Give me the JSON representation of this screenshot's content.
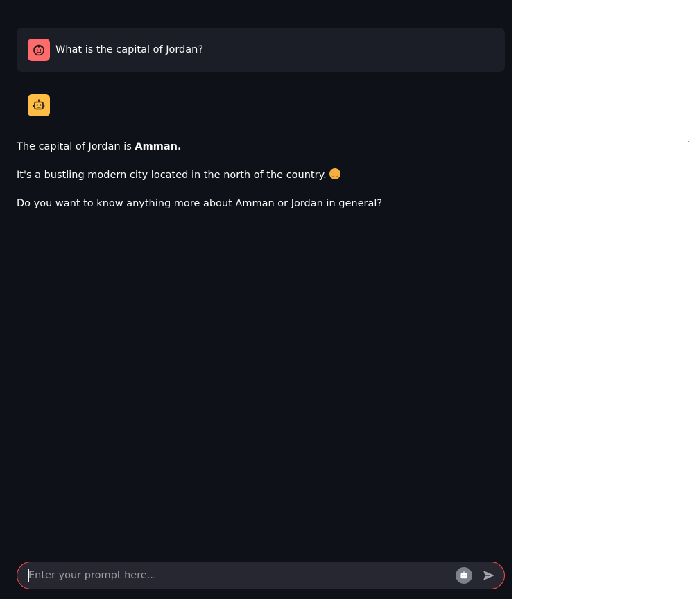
{
  "messages": {
    "user": {
      "text": "What is the capital of Jordan?",
      "avatar_icon": "face-icon",
      "avatar_color": "#ff6b6b"
    },
    "assistant": {
      "avatar_icon": "robot-icon",
      "avatar_color": "#ffbd45",
      "line1_prefix": "The capital of Jordan is ",
      "line1_bold": "Amman.",
      "line2": "It's a bustling modern city located in the north of the country.",
      "line2_emoji": "smiling-face-emoji",
      "line3": "Do you want to know anything more about Amman or Jordan in general?"
    }
  },
  "chat_input": {
    "placeholder": "Enter your prompt here...",
    "value": "",
    "border_color": "#ff4b4b",
    "left_icon": "robot-icon",
    "send_icon": "send-icon"
  },
  "theme": {
    "background": "#0e1117",
    "user_bubble": "#1b1e26",
    "text": "#fafafa"
  }
}
